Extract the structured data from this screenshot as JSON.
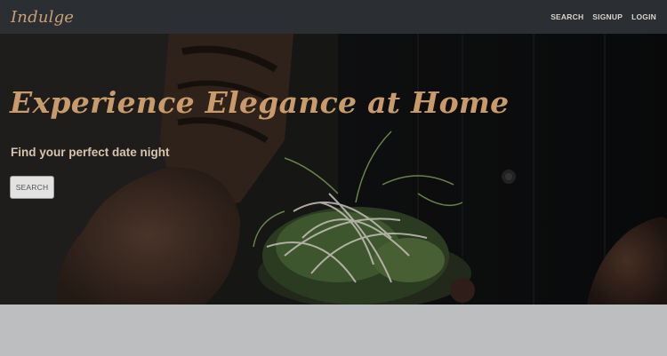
{
  "navbar": {
    "brand": "Indulge",
    "links": [
      "SEARCH",
      "SIGNUP",
      "LOGIN"
    ]
  },
  "hero": {
    "title": "Experience Elegance at Home",
    "subtitle": "Find your perfect date night",
    "button_label": "SEARCH",
    "image_description_icon": "chef-plating-salad-photo"
  },
  "colors": {
    "navbar_bg": "#2b2e33",
    "accent_gold": "#c99a6a",
    "footer_bg": "#bdbec0"
  }
}
